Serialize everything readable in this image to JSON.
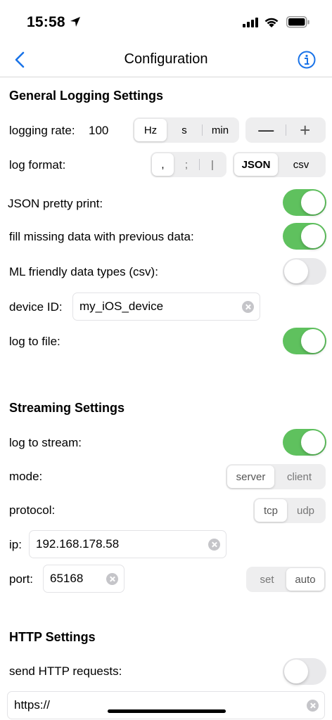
{
  "status_bar": {
    "time": "15:58"
  },
  "nav": {
    "title": "Configuration"
  },
  "general": {
    "title": "General Logging Settings",
    "logging_rate_label": "logging rate:",
    "logging_rate_value": "100",
    "rate_units": [
      "Hz",
      "s",
      "min"
    ],
    "rate_unit_selected": "Hz",
    "stepper_minus": "—",
    "stepper_plus": "+",
    "log_format_label": "log format:",
    "separators": [
      ",",
      ";",
      "|"
    ],
    "separator_selected": ",",
    "formats": [
      "JSON",
      "csv"
    ],
    "format_selected": "JSON",
    "json_pretty_label": "JSON pretty print:",
    "json_pretty_on": true,
    "fill_missing_label": "fill missing data with previous data:",
    "fill_missing_on": true,
    "ml_friendly_label": "ML friendly data types (csv):",
    "ml_friendly_on": false,
    "device_id_label": "device ID:",
    "device_id_value": "my_iOS_device",
    "log_to_file_label": "log to file:",
    "log_to_file_on": true
  },
  "streaming": {
    "title": "Streaming Settings",
    "log_to_stream_label": "log to stream:",
    "log_to_stream_on": true,
    "mode_label": "mode:",
    "modes": [
      "server",
      "client"
    ],
    "mode_selected": "server",
    "protocol_label": "protocol:",
    "protocols": [
      "tcp",
      "udp"
    ],
    "protocol_selected": "tcp",
    "ip_label": "ip:",
    "ip_value": "192.168.178.58",
    "port_label": "port:",
    "port_value": "65168",
    "port_modes": [
      "set",
      "auto"
    ],
    "port_mode_selected": "auto"
  },
  "http": {
    "title": "HTTP Settings",
    "send_requests_label": "send HTTP requests:",
    "send_requests_on": false,
    "url_value": "https://"
  },
  "colors": {
    "accent": "#1a73e8",
    "toggle_on": "#5fc15e",
    "toggle_off": "#e9e9eb"
  }
}
